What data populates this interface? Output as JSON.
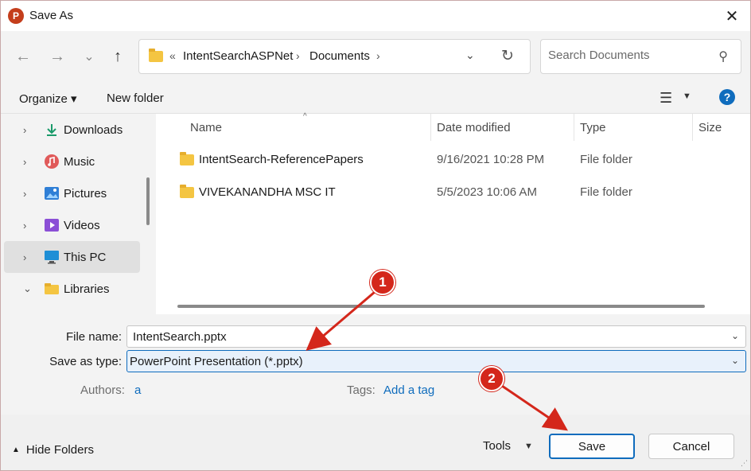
{
  "window": {
    "title": "Save As",
    "app_icon": "P"
  },
  "nav": {
    "back_icon": "←",
    "forward_icon": "→",
    "recent_icon": "⌄",
    "up_icon": "↑",
    "breadcrumb": {
      "overflow": "«",
      "items": [
        "IntentSearchASPNet",
        "Documents"
      ],
      "sep": "›"
    },
    "dropdown_icon": "⌄",
    "refresh_icon": "↻"
  },
  "search": {
    "placeholder": "Search Documents"
  },
  "toolbar": {
    "organize": "Organize ▾",
    "new_folder": "New folder",
    "help": "?"
  },
  "sidebar": {
    "items": [
      {
        "label": "Downloads",
        "chev": "›"
      },
      {
        "label": "Music",
        "chev": "›"
      },
      {
        "label": "Pictures",
        "chev": "›"
      },
      {
        "label": "Videos",
        "chev": "›"
      },
      {
        "label": "This PC",
        "chev": "›"
      },
      {
        "label": "Libraries",
        "chev": "⌄"
      }
    ]
  },
  "filelist": {
    "columns": [
      "Name",
      "Date modified",
      "Type",
      "Size"
    ],
    "rows": [
      {
        "name": "IntentSearch-ReferencePapers",
        "date": "9/16/2021 10:28 PM",
        "type": "File folder"
      },
      {
        "name": "VIVEKANANDHA MSC IT",
        "date": "5/5/2023 10:06 AM",
        "type": "File folder"
      }
    ]
  },
  "form": {
    "file_name_label": "File name:",
    "file_name_value": "IntentSearch.pptx",
    "save_type_label": "Save as type:",
    "save_type_value": "PowerPoint Presentation (*.pptx)",
    "authors_label": "Authors:",
    "authors_value": "a",
    "tags_label": "Tags:",
    "tags_value": "Add a tag"
  },
  "footer": {
    "hide_folders": "Hide Folders",
    "hide_icon": "▲",
    "tools": "Tools",
    "save": "Save",
    "cancel": "Cancel"
  },
  "annotations": [
    "1",
    "2"
  ],
  "colors": {
    "accent": "#0f6cbd",
    "annotation": "#d4271b",
    "folder": "#f4c542"
  }
}
